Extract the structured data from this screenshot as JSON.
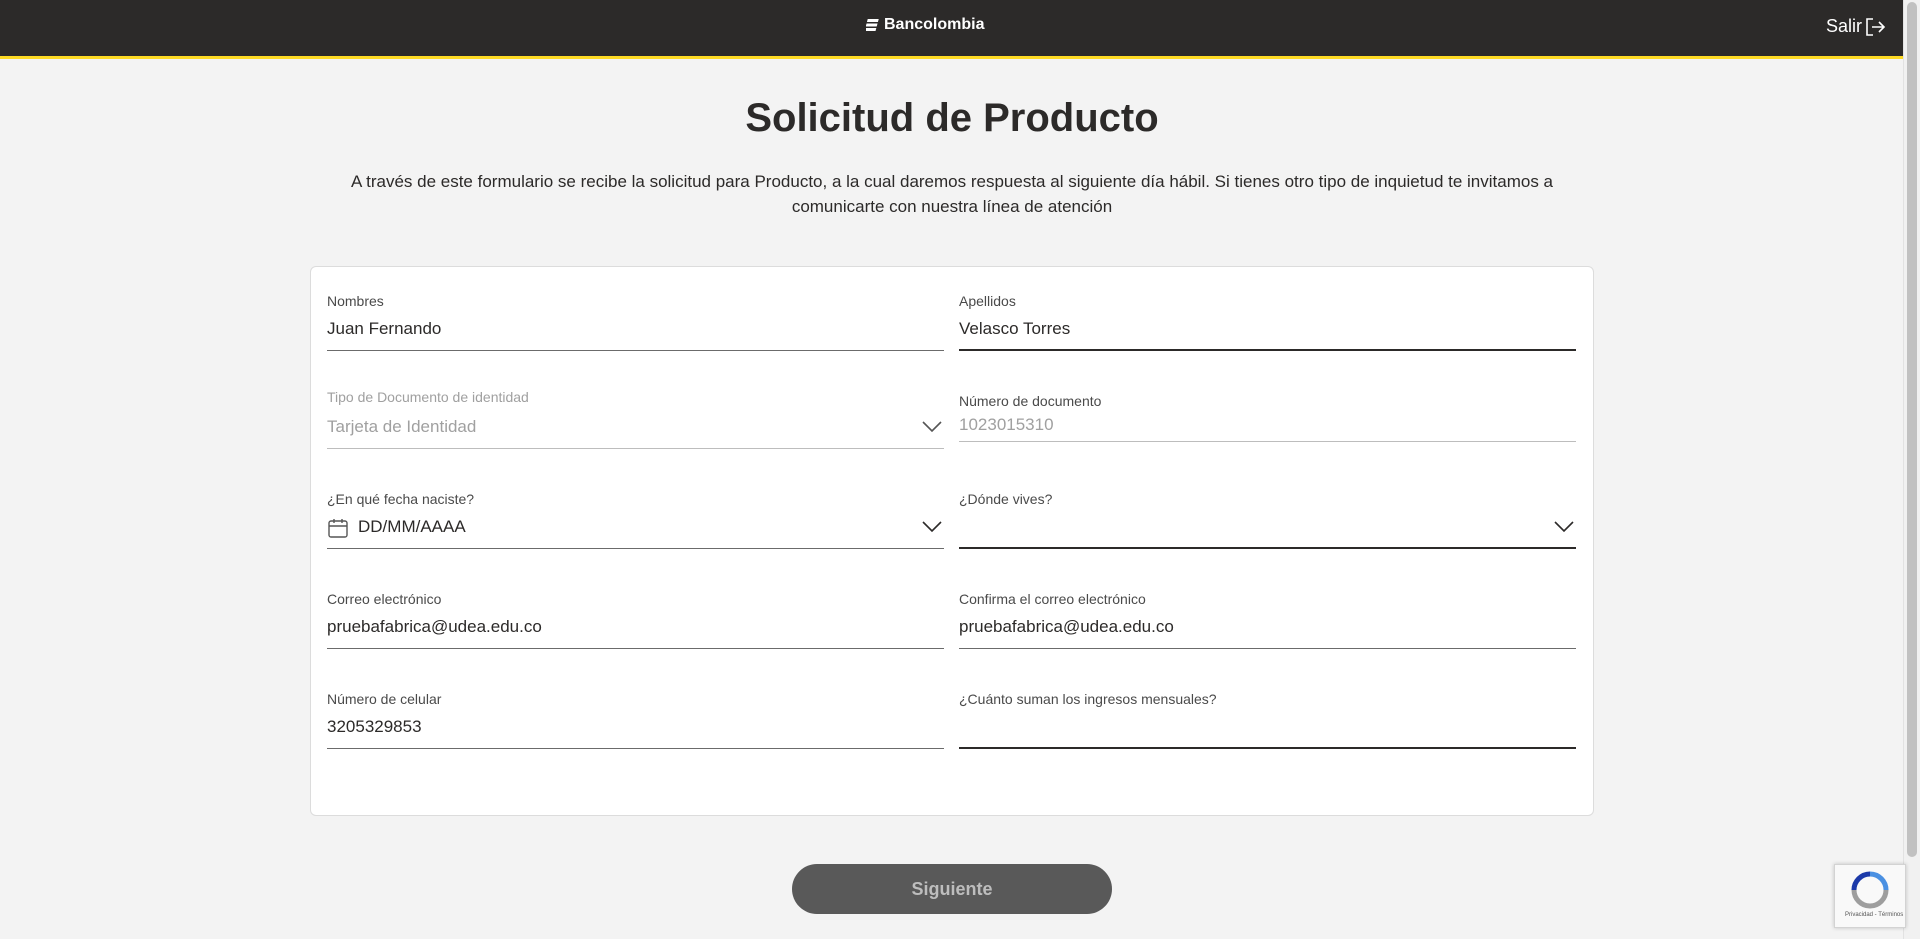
{
  "header": {
    "brand": "Bancolombia",
    "exit_label": "Salir"
  },
  "page": {
    "title": "Solicitud de Producto",
    "intro": "A través de este formulario se recibe la solicitud para Producto, a la cual daremos respuesta al siguiente día hábil. Si tienes otro tipo de inquietud te invitamos a comunicarte con nuestra línea de atención"
  },
  "form": {
    "nombres": {
      "label": "Nombres",
      "value": "Juan Fernando"
    },
    "apellidos": {
      "label": "Apellidos",
      "value": "Velasco Torres"
    },
    "tipo_documento": {
      "label": "Tipo de Documento de identidad",
      "value": "Tarjeta de Identidad"
    },
    "numero_documento": {
      "label": "Número de documento",
      "value": "1023015310"
    },
    "fecha_nacimiento": {
      "label": "¿En qué fecha naciste?",
      "value": "DD/MM/AAAA"
    },
    "donde_vives": {
      "label": "¿Dónde vives?",
      "value": ""
    },
    "correo": {
      "label": "Correo electrónico",
      "value": "pruebafabrica@udea.edu.co"
    },
    "confirma_correo": {
      "label": "Confirma el correo electrónico",
      "value": "pruebafabrica@udea.edu.co"
    },
    "celular": {
      "label": "Número de celular",
      "value": "3205329853"
    },
    "ingresos": {
      "label": "¿Cuánto suman los ingresos mensuales?",
      "value": ""
    }
  },
  "actions": {
    "next_label": "Siguiente"
  },
  "recaptcha": {
    "links": "Privacidad - Términos"
  },
  "colors": {
    "header_bg": "#2c2a29",
    "accent": "#fdda24",
    "button_bg": "#595959"
  },
  "icons": [
    "bancolombia-logo-icon",
    "exit-icon",
    "chevron-down-icon",
    "calendar-icon",
    "recaptcha-icon"
  ]
}
